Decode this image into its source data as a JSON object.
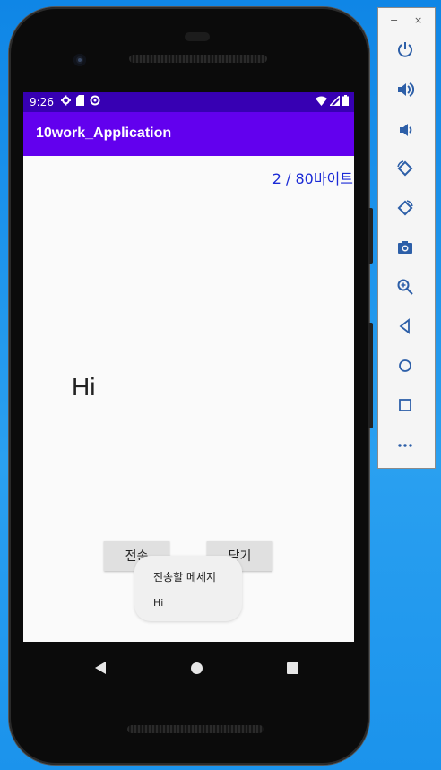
{
  "status_bar": {
    "time": "9:26"
  },
  "app": {
    "title": "10work_Application",
    "byte_counter": "2 / 80바이트",
    "message_text": "Hi",
    "buttons": {
      "send": "전송",
      "close": "닫기"
    },
    "toast": {
      "title": "전송할 메세지",
      "message": "Hi"
    }
  },
  "emulator_panel": {
    "window_controls": {
      "minimize": "−",
      "close": "×"
    },
    "buttons": [
      "power-icon",
      "volume-up-icon",
      "volume-down-icon",
      "rotate-left-icon",
      "rotate-right-icon",
      "screenshot-icon",
      "zoom-icon",
      "back-icon",
      "home-icon",
      "overview-icon",
      "more-icon"
    ]
  },
  "colors": {
    "status_bar": "#3700b3",
    "app_bar": "#6200ee",
    "byte_counter": "#1a2ad6",
    "desktop": "#1890e8",
    "emulator_icons": "#2d5fa8"
  }
}
